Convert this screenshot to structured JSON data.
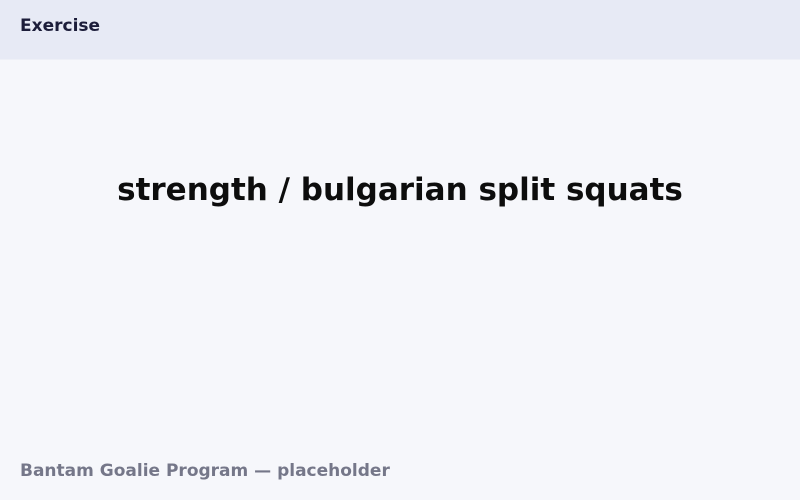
{
  "header": {
    "title": "Exercise"
  },
  "main": {
    "exercise_name": "strength / bulgarian split squats"
  },
  "footer": {
    "program_label": "Bantam Goalie Program — placeholder"
  },
  "colors": {
    "header_background": "#e7eaf5",
    "page_background": "#f6f7fb",
    "title_text": "#1c1d3a",
    "exercise_text": "#0d0d0d",
    "footer_text": "#757789"
  }
}
